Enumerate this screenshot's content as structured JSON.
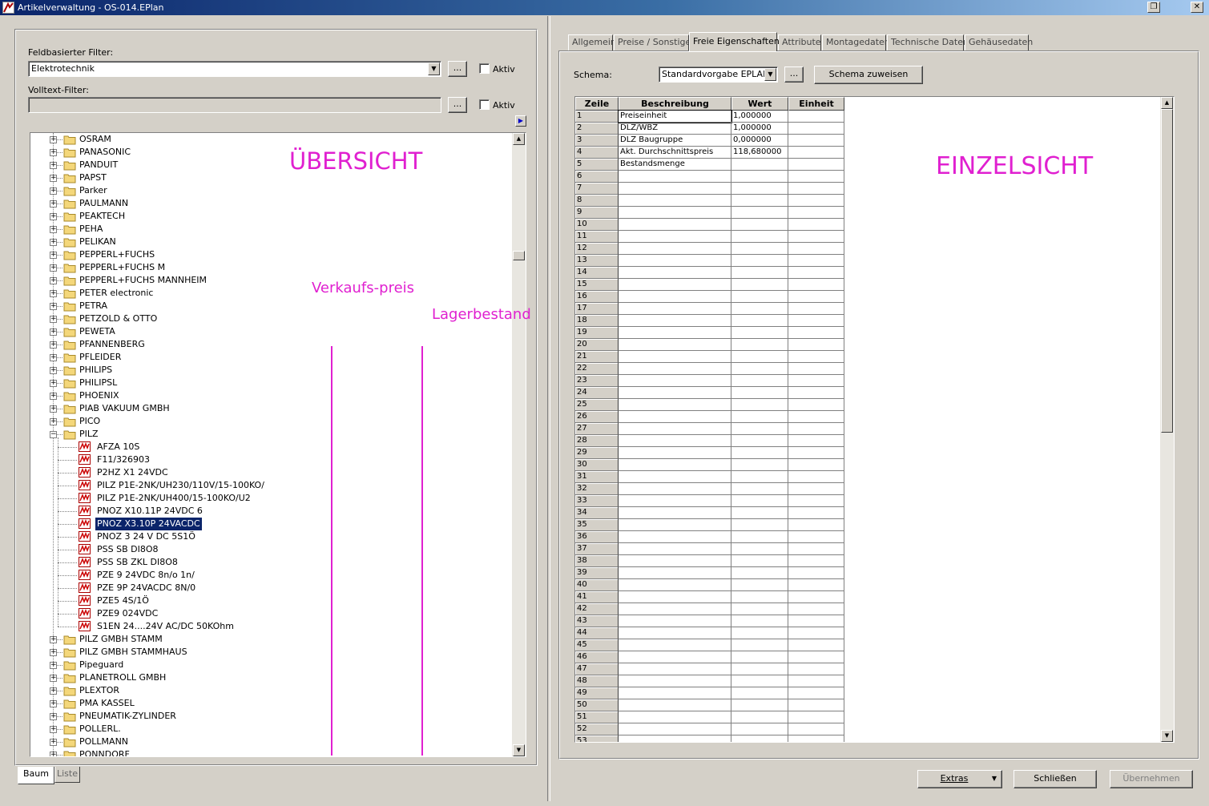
{
  "window": {
    "title": "Artikelverwaltung - OS-014.EPlan"
  },
  "filters": {
    "field_filter_label": "Feldbasierter Filter:",
    "field_filter_value": "Elektrotechnik",
    "fulltext_filter_label": "Volltext-Filter:",
    "more_label": "...",
    "active_label": "Aktiv"
  },
  "tree": {
    "nodes_before": [
      "OSRAM",
      "PANASONIC",
      "PANDUIT",
      "PAPST",
      "Parker",
      "PAULMANN",
      "PEAKTECH",
      "PEHA",
      "PELIKAN",
      "PEPPERL+FUCHS",
      "PEPPERL+FUCHS M",
      "PEPPERL+FUCHS MANNHEIM",
      "PETER electronic",
      "PETRA",
      "PETZOLD & OTTO",
      "PEWETA",
      "PFANNENBERG",
      "PFLEIDER",
      "PHILIPS",
      "PHILIPSL",
      "PHOENIX",
      "PIAB VAKUUM GMBH",
      "PICO"
    ],
    "expanded_node": "PILZ",
    "children": [
      "AFZA 10S",
      "F11/326903",
      "P2HZ X1 24VDC",
      "PILZ P1E-2NK/UH230/110V/15-100KO/",
      "PILZ P1E-2NK/UH400/15-100KO/U2",
      "PNOZ X10.11P 24VDC 6",
      "PNOZ X3.10P  24VACDC",
      "PNOZ 3 24 V DC 5S1Ö",
      "PSS SB DI8O8",
      "PSS SB ZKL DI8O8",
      "PZE 9 24VDC 8n/o 1n/",
      "PZE 9P 24VACDC 8N/0",
      "PZE5 4S/1Ö",
      "PZE9 024VDC",
      "S1EN 24....24V AC/DC 50KOhm"
    ],
    "selected_child": 6,
    "nodes_after": [
      "PILZ GMBH STAMM",
      "PILZ GMBH STAMMHAUS",
      "Pipeguard",
      "PLANETROLL GMBH",
      "PLEXTOR",
      "PMA KASSEL",
      "PNEUMATIK-ZYLINDER",
      "POLLERL.",
      "POLLMANN",
      "PONNDORF"
    ]
  },
  "annotations": {
    "overview": "ÜBERSICHT",
    "sales_price": "Verkaufs-preis",
    "stock": "Lagerbestand",
    "single_view": "EINZELSICHT",
    "color": "#e020d0"
  },
  "bottom_tabs": [
    "Baum",
    "Liste"
  ],
  "tabs": [
    "Allgemein",
    "Preise / Sonstiges",
    "Freie Eigenschaften",
    "Attribute",
    "Montagedaten",
    "Technische Daten",
    "Gehäusedaten"
  ],
  "active_tab": 2,
  "schema": {
    "label": "Schema:",
    "value": "Standardvorgabe EPLAN",
    "more_label": "...",
    "assign_button": "Schema zuweisen"
  },
  "grid": {
    "headers": [
      "Zeile",
      "Beschreibung",
      "Wert",
      "Einheit"
    ],
    "rows": [
      {
        "line": "1",
        "desc": "Preiseinheit",
        "value": "1,000000",
        "unit": ""
      },
      {
        "line": "2",
        "desc": "DLZ/WBZ",
        "value": "1,000000",
        "unit": ""
      },
      {
        "line": "3",
        "desc": "DLZ Baugruppe",
        "value": "0,000000",
        "unit": ""
      },
      {
        "line": "4",
        "desc": "Akt. Durchschnittspreis",
        "value": "118,680000",
        "unit": ""
      },
      {
        "line": "5",
        "desc": "Bestandsmenge",
        "value": "",
        "unit": ""
      }
    ],
    "empty_row_count": 48
  },
  "footer": {
    "extras": "Extras",
    "close": "Schließen",
    "apply": "Übernehmen"
  }
}
